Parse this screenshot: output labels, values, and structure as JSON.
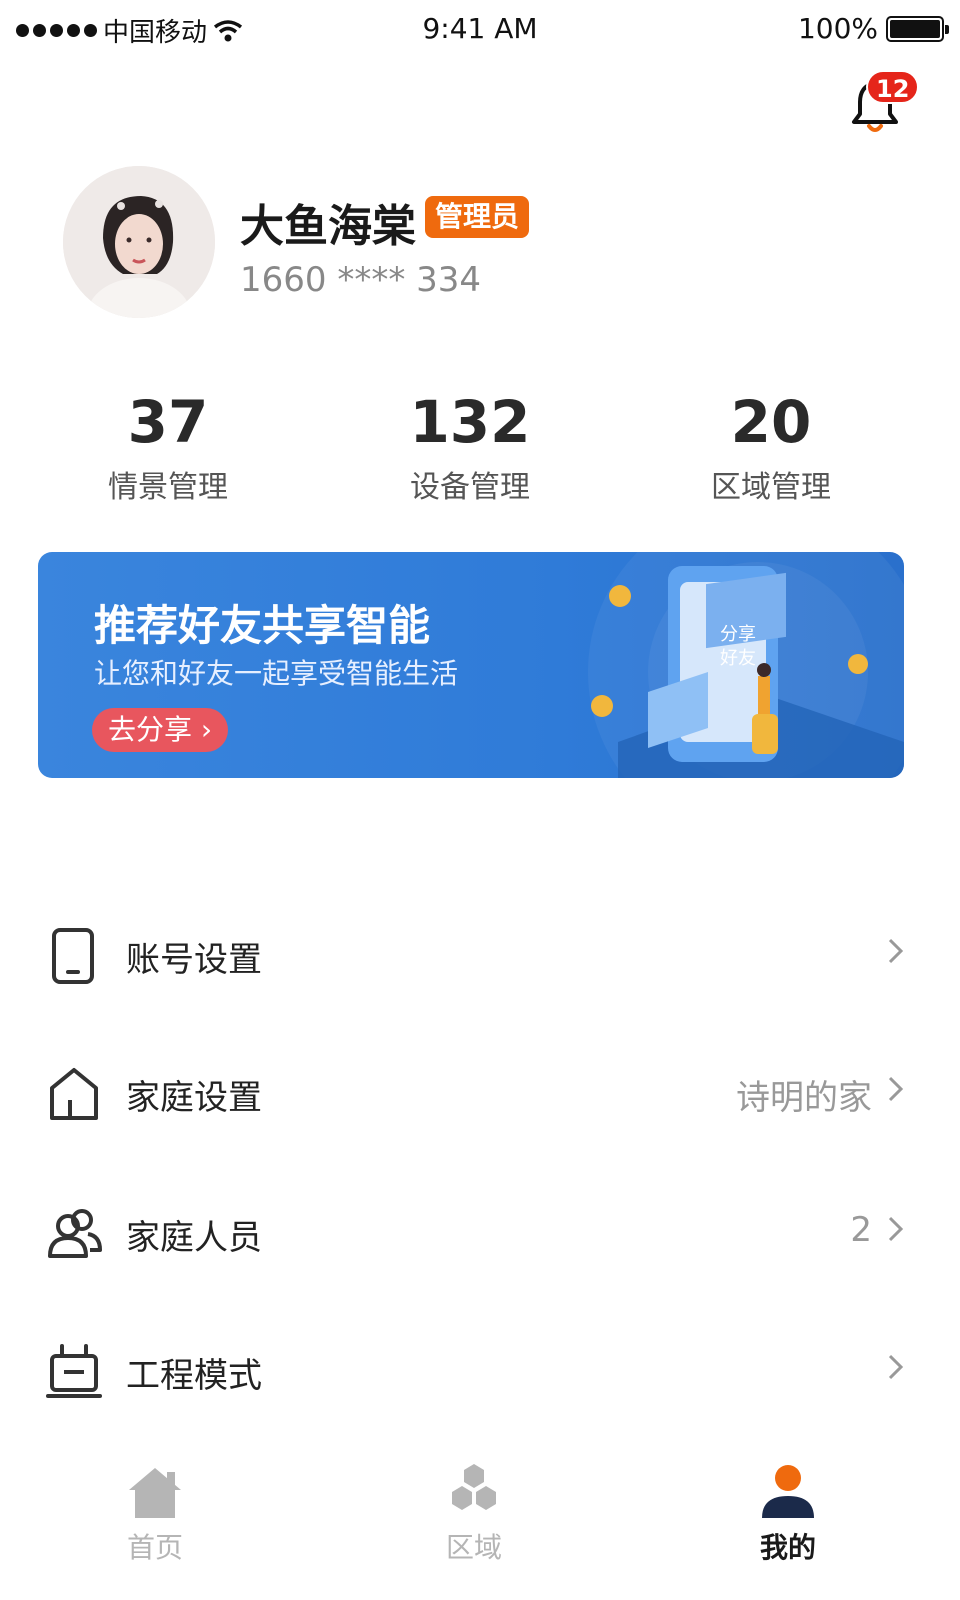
{
  "status_bar": {
    "carrier": "中国移动",
    "time": "9:41 AM",
    "battery": "100%"
  },
  "notifications": {
    "icon": "bell-icon",
    "count": "12",
    "badge_color": "#e5251a"
  },
  "profile": {
    "name": "大鱼海棠",
    "role": "管理员",
    "phone": "1660 **** 334",
    "role_color": "#ef6a0e"
  },
  "stats": [
    {
      "value": "37",
      "label": "情景管理"
    },
    {
      "value": "132",
      "label": "设备管理"
    },
    {
      "value": "20",
      "label": "区域管理"
    }
  ],
  "banner": {
    "title": "推荐好友共享智能",
    "subtitle": "让您和好友一起享受智能生活",
    "button": "去分享",
    "art_text_1": "分享",
    "art_text_2": "好友",
    "background": "#3a85dd"
  },
  "menu": [
    {
      "icon": "phone-icon",
      "label": "账号设置",
      "value": ""
    },
    {
      "icon": "house-icon",
      "label": "家庭设置",
      "value": "诗明的家"
    },
    {
      "icon": "people-icon",
      "label": "家庭人员",
      "value": "2"
    },
    {
      "icon": "robot-icon",
      "label": "工程模式",
      "value": ""
    }
  ],
  "tabs": [
    {
      "icon": "home-icon",
      "label": "首页",
      "active": false
    },
    {
      "icon": "hexagons-icon",
      "label": "区域",
      "active": false
    },
    {
      "icon": "user-icon",
      "label": "我的",
      "active": true
    }
  ],
  "accent_color": "#ef6a0e"
}
